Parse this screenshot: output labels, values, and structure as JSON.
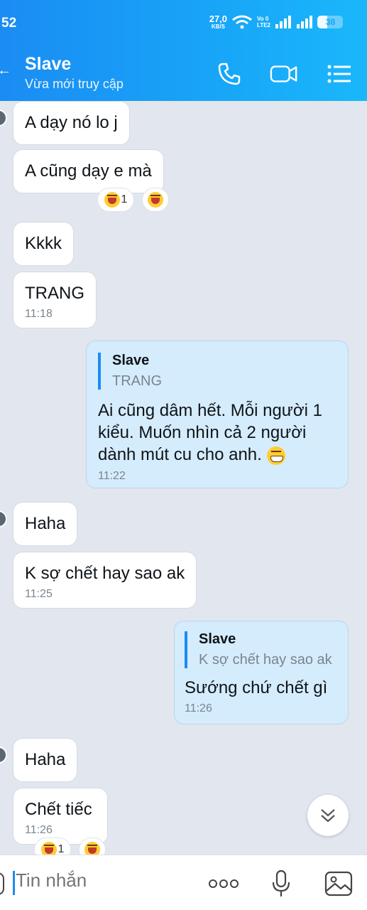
{
  "status_bar": {
    "time": "52",
    "net_speed": "27,0",
    "net_unit": "KB/S",
    "lte_top": "Vo 0",
    "lte_bottom": "LTE2",
    "battery": "38",
    "battery_level": 0.38
  },
  "header": {
    "contact_name": "Slave",
    "contact_status": "Vừa mới truy cập"
  },
  "messages": [
    {
      "dir": "in",
      "text": "A dạy nó lo j"
    },
    {
      "dir": "in",
      "text": "A cũng dạy e mà",
      "reaction_count": "1"
    },
    {
      "dir": "in",
      "text": "Kkkk"
    },
    {
      "dir": "in",
      "text": "TRANG",
      "time": "11:18"
    },
    {
      "dir": "out",
      "quote_name": "Slave",
      "quote_text": "TRANG",
      "text": "Ai cũng dâm hết. Mỗi người 1 kiểu. Muốn nhìn cả 2 người dành mút cu cho anh.",
      "time": "11:22"
    },
    {
      "dir": "in",
      "text": "Haha"
    },
    {
      "dir": "in",
      "text": "K sợ chết hay sao ak",
      "time": "11:25"
    },
    {
      "dir": "out",
      "quote_name": "Slave",
      "quote_text": "K sợ chết hay sao ak",
      "text": "Sướng chứ chết gì",
      "time": "11:26"
    },
    {
      "dir": "in",
      "text": "Haha"
    },
    {
      "dir": "in",
      "text": "Chết tiếc",
      "time": "11:26",
      "reaction_count": "1"
    }
  ],
  "input": {
    "placeholder": "Tin nhắn"
  },
  "colors": {
    "accent": "#1a8cf3",
    "outgoing_bubble": "#d5ecfc",
    "chat_bg": "#e2e6ee"
  }
}
